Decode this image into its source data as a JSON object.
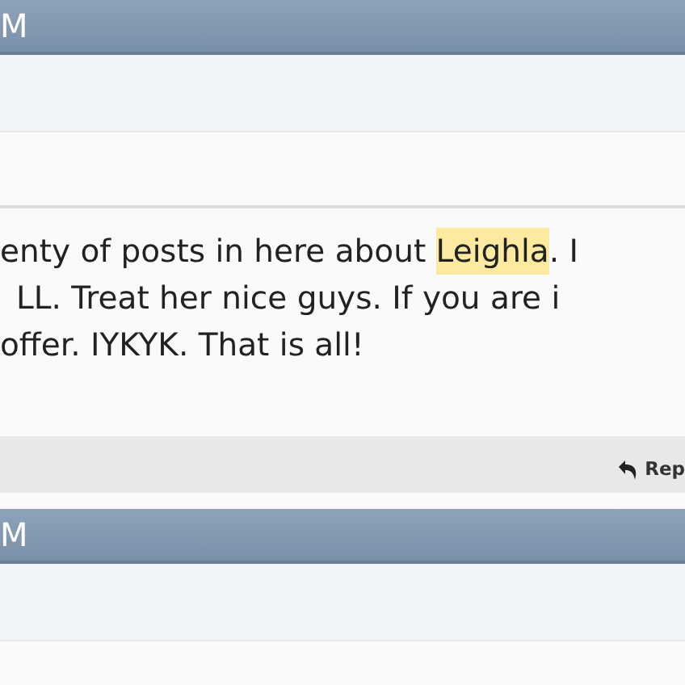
{
  "posts": [
    {
      "header": "M",
      "body": [
        [
          {
            "text": "enty of posts in here about ",
            "highlighted": false
          },
          {
            "text": "Leighla",
            "highlighted": true
          },
          {
            "text": ". I",
            "highlighted": false
          }
        ],
        [
          {
            "text": "LL. Treat her nice guys. If you are i",
            "highlighted": false
          }
        ],
        [
          {
            "text": "offer. IYKYK. That is all!",
            "highlighted": false
          }
        ]
      ],
      "reply": "Rep"
    },
    {
      "header": "M"
    }
  ]
}
